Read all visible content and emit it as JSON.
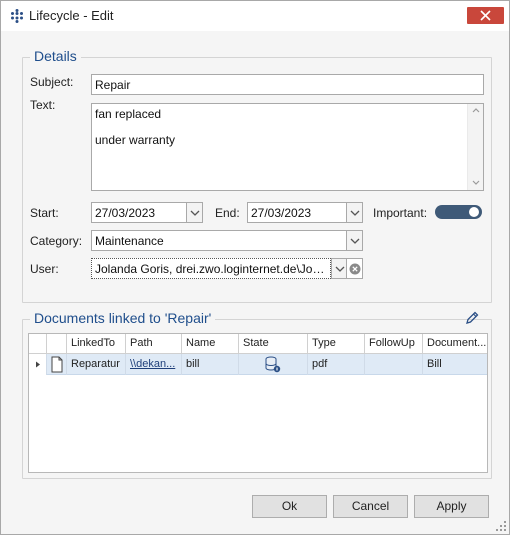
{
  "window": {
    "title": "Lifecycle - Edit"
  },
  "details": {
    "legend": "Details",
    "subject_label": "Subject:",
    "subject_value": "Repair",
    "text_label": "Text:",
    "text_lines": [
      "fan replaced",
      "under warranty"
    ],
    "start_label": "Start:",
    "start_value": "27/03/2023",
    "end_label": "End:",
    "end_value": "27/03/2023",
    "important_label": "Important:",
    "important_on": true,
    "category_label": "Category:",
    "category_value": "Maintenance",
    "user_label": "User:",
    "user_value": "Jolanda Goris, drei.zwo.loginternet.de\\Joland..."
  },
  "documents": {
    "legend": "Documents linked to 'Repair'",
    "columns": [
      "LinkedTo",
      "Path",
      "Name",
      "State",
      "Type",
      "FollowUp",
      "Document..."
    ],
    "rows": [
      {
        "linked_to": "Reparatur",
        "path": "\\\\dekan...",
        "name": "bill",
        "state_icon": "database-info-icon",
        "type": "pdf",
        "follow_up": "",
        "document": "Bill"
      }
    ]
  },
  "buttons": {
    "ok": "Ok",
    "cancel": "Cancel",
    "apply": "Apply"
  },
  "colors": {
    "close": "#c9473b",
    "legend": "#1f4e8c",
    "toggle": "#3f5a78",
    "row_selected": "#dfeaf6"
  }
}
